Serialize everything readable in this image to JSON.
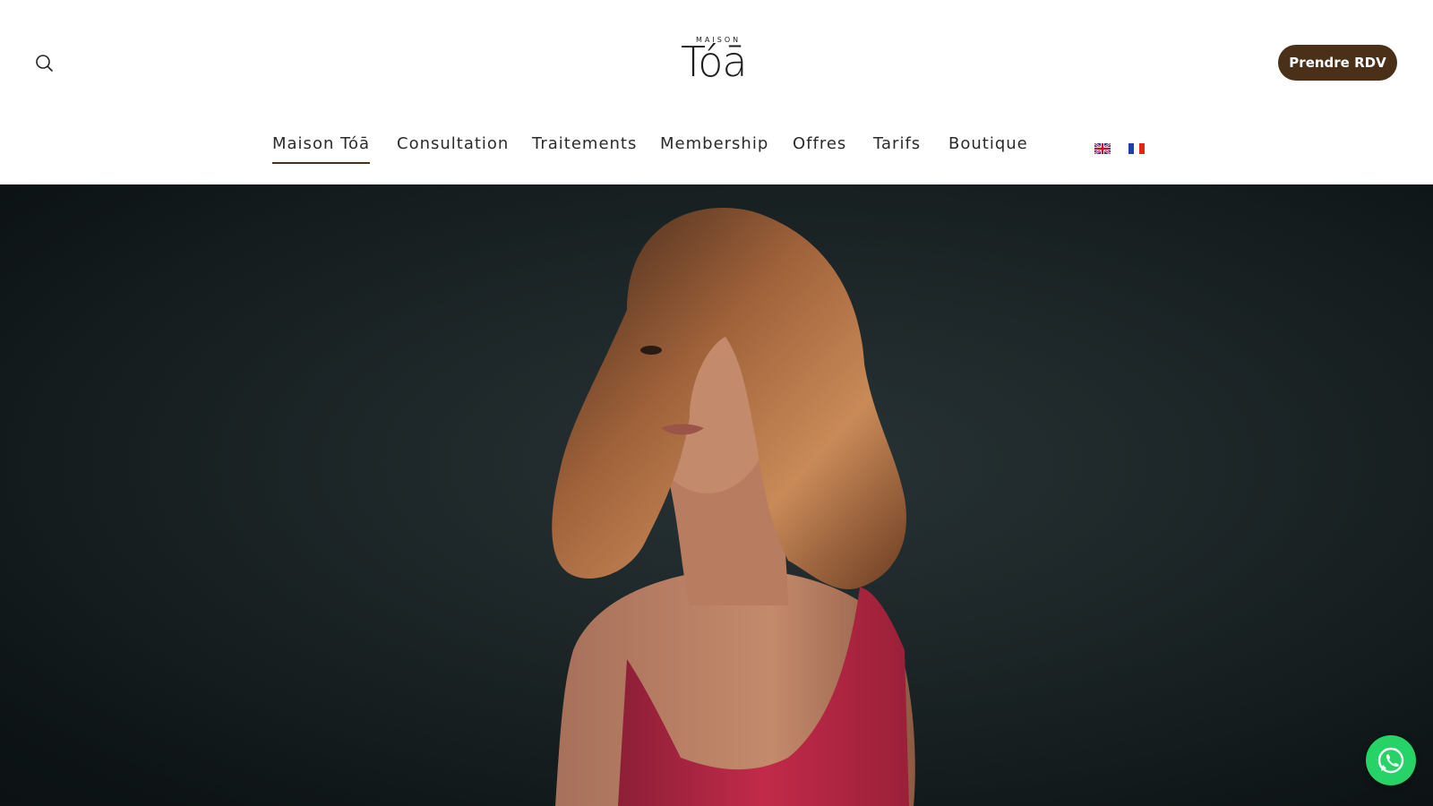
{
  "header": {
    "logo_top": "MAISON",
    "logo_word": "Tóā",
    "cta_label": "Prendre RDV"
  },
  "nav": {
    "items": [
      {
        "label": "Maison Tóā",
        "active": true
      },
      {
        "label": "Consultation",
        "active": false
      },
      {
        "label": "Traitements",
        "active": false
      },
      {
        "label": "Membership",
        "active": false
      },
      {
        "label": "Offres",
        "active": false
      },
      {
        "label": "Tarifs",
        "active": false
      },
      {
        "label": "Boutique",
        "active": false
      }
    ],
    "languages": [
      {
        "code": "en",
        "icon": "uk-flag-icon"
      },
      {
        "code": "fr",
        "icon": "france-flag-icon"
      }
    ]
  },
  "hero": {
    "media_icon": "hero-video"
  },
  "colors": {
    "accent": "#4a3018",
    "whatsapp": "#25d366",
    "hero_bg": "#1b2527"
  }
}
